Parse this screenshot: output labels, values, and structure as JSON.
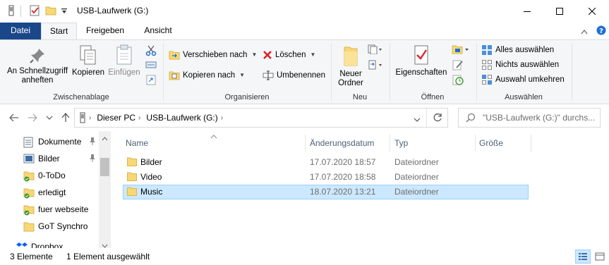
{
  "window": {
    "title": "USB-Laufwerk (G:)",
    "minimize_label": "",
    "maximize_label": "",
    "close_label": ""
  },
  "tabs": {
    "file": "Datei",
    "start": "Start",
    "share": "Freigeben",
    "view": "Ansicht"
  },
  "ribbon": {
    "clipboard": {
      "label": "Zwischenablage",
      "pin_quick_access": "An Schnellzugriff anheften",
      "copy": "Kopieren",
      "paste": "Einfügen"
    },
    "organize": {
      "label": "Organisieren",
      "move_to": "Verschieben nach",
      "copy_to": "Kopieren nach",
      "delete": "Löschen",
      "rename": "Umbenennen"
    },
    "new": {
      "label": "Neu",
      "new_folder": "Neuer Ordner"
    },
    "open": {
      "label": "Öffnen",
      "properties": "Eigenschaften"
    },
    "select": {
      "label": "Auswählen",
      "select_all": "Alles auswählen",
      "select_none": "Nichts auswählen",
      "invert_selection": "Auswahl umkehren"
    }
  },
  "address": {
    "crumbs": [
      "Dieser PC",
      "USB-Laufwerk (G:)"
    ],
    "search_placeholder": "\"USB-Laufwerk (G:)\" durchs..."
  },
  "nav_pane": {
    "items": [
      {
        "label": "Dokumente",
        "icon": "documents-icon",
        "pinned": true
      },
      {
        "label": "Bilder",
        "icon": "pictures-icon",
        "pinned": true
      },
      {
        "label": "0-ToDo",
        "icon": "folder-sync-icon",
        "pinned": false
      },
      {
        "label": "erledigt",
        "icon": "folder-sync-icon",
        "pinned": false
      },
      {
        "label": "fuer webseite",
        "icon": "folder-sync-icon",
        "pinned": false
      },
      {
        "label": "GoT Synchro",
        "icon": "folder-icon",
        "pinned": false
      },
      {
        "label": "Dropbox",
        "icon": "dropbox-icon",
        "pinned": false
      }
    ]
  },
  "file_list": {
    "columns": {
      "name": "Name",
      "date": "Änderungsdatum",
      "type": "Typ",
      "size": "Größe"
    },
    "rows": [
      {
        "name": "Bilder",
        "date": "17.07.2020 18:57",
        "type": "Dateiordner",
        "size": "",
        "selected": false
      },
      {
        "name": "Video",
        "date": "17.07.2020 18:58",
        "type": "Dateiordner",
        "size": "",
        "selected": false
      },
      {
        "name": "Music",
        "date": "18.07.2020 13:21",
        "type": "Dateiordner",
        "size": "",
        "selected": true
      }
    ]
  },
  "status": {
    "item_count": "3 Elemente",
    "selection": "1 Element ausgewählt"
  },
  "colors": {
    "file_tab": "#19478a",
    "selection_bg": "#cce8ff",
    "selection_border": "#99d1ff",
    "folder_yellow": "#f8d775",
    "delete_red": "#d9262b"
  }
}
